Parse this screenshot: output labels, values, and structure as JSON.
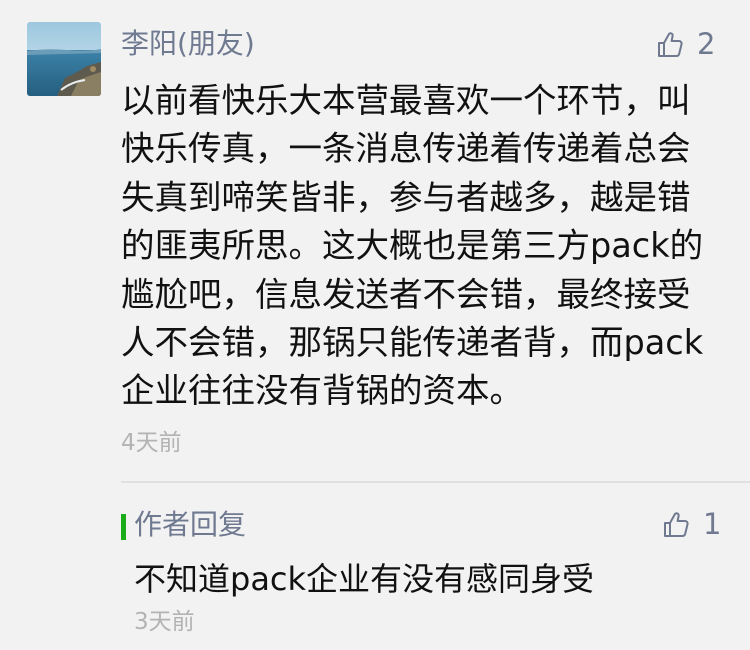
{
  "comment": {
    "username": "李阳(朋友)",
    "like_count": "2",
    "text": "以前看快乐大本营最喜欢一个环节，叫快乐传真，一条消息传递着传递着总会失真到啼笑皆非，参与者越多，越是错的匪夷所思。这大概也是第三方pack的尴尬吧，信息发送者不会错，最终接受人不会错，那锅只能传递者背，而pack企业往往没有背锅的资本。",
    "time": "4天前"
  },
  "reply": {
    "author_label": "作者回复",
    "like_count": "1",
    "text": "不知道pack企业有没有感同身受",
    "time": "3天前"
  },
  "icons": {
    "avatar": "seaside-rocks-avatar",
    "like": "thumbs-up-icon"
  },
  "colors": {
    "background": "#f2f2f2",
    "name_text": "#6f7990",
    "body_text": "#111111",
    "time_text": "#b3b3b3",
    "reply_accent": "#1aad19",
    "divider": "#e0e0e0"
  }
}
